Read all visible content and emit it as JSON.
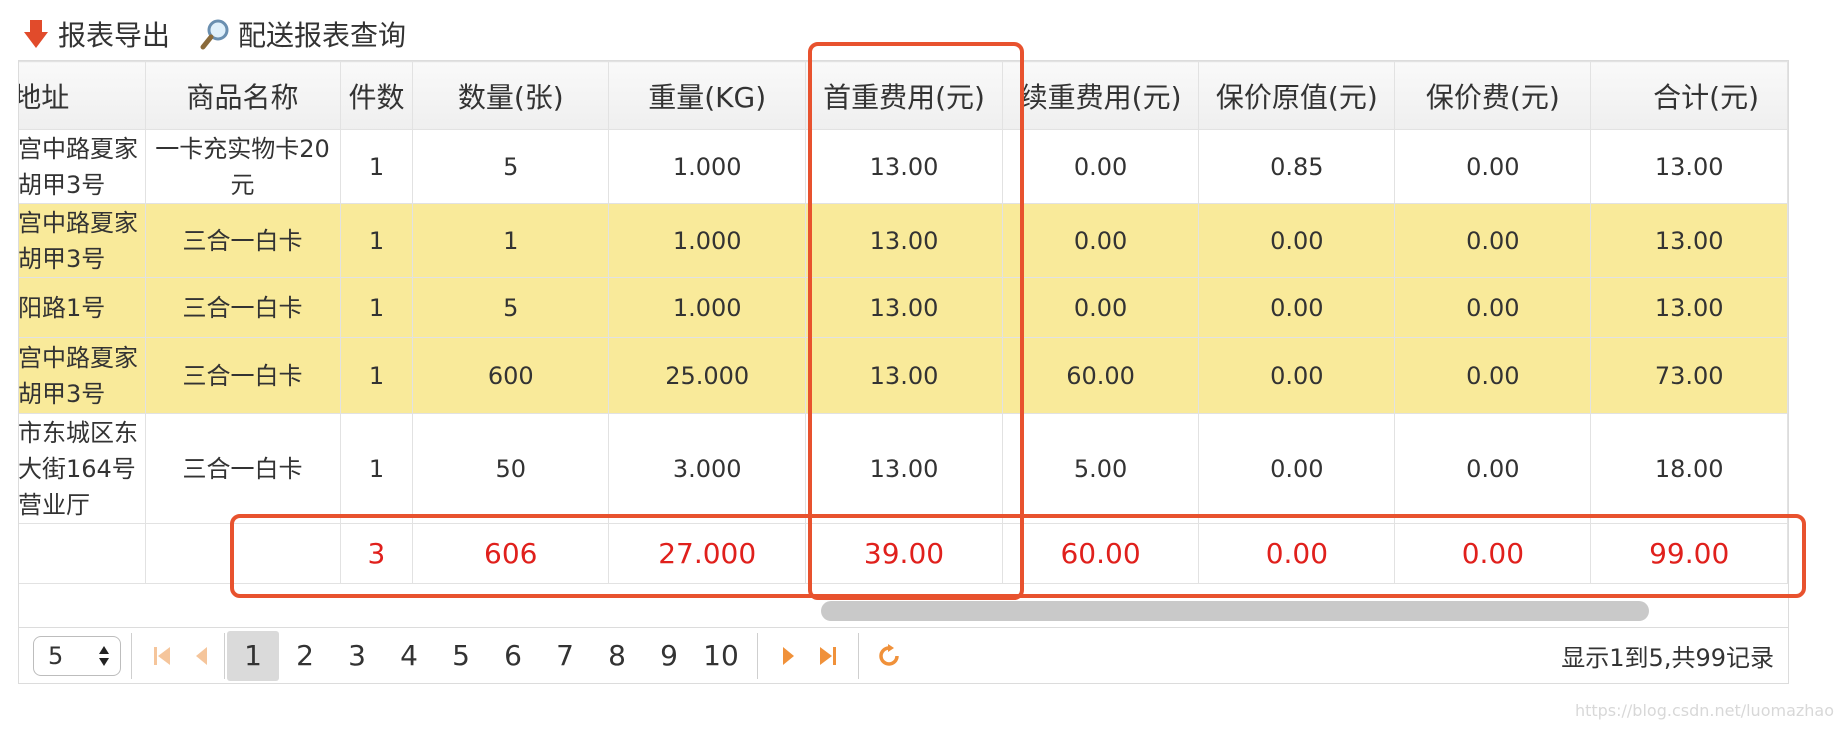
{
  "toolbar": {
    "export_label": "报表导出",
    "query_label": "配送报表查询"
  },
  "table": {
    "headers": [
      "送地址",
      "商品名称",
      "件数",
      "数量(张)",
      "重量(KG)",
      "首重费用(元)",
      "续重费用(元)",
      "保价原值(元)",
      "保价费(元)",
      "合计(元)"
    ],
    "rows": [
      {
        "addr": [
          "宫中路夏家",
          "胡甲3号"
        ],
        "name": "一卡充实物卡20元",
        "pieces": "1",
        "qty": "5",
        "weight": "1.000",
        "first_fee": "13.00",
        "cont_fee": "0.00",
        "insured_val": "0.85",
        "insure_fee": "0.00",
        "total": "13.00"
      },
      {
        "addr": [
          "宫中路夏家",
          "胡甲3号"
        ],
        "name": "三合一白卡",
        "pieces": "1",
        "qty": "1",
        "weight": "1.000",
        "first_fee": "13.00",
        "cont_fee": "0.00",
        "insured_val": "0.00",
        "insure_fee": "0.00",
        "total": "13.00"
      },
      {
        "addr": [
          "阳路1号"
        ],
        "name": "三合一白卡",
        "pieces": "1",
        "qty": "5",
        "weight": "1.000",
        "first_fee": "13.00",
        "cont_fee": "0.00",
        "insured_val": "0.00",
        "insure_fee": "0.00",
        "total": "13.00"
      },
      {
        "addr": [
          "宫中路夏家",
          "胡甲3号"
        ],
        "name": "三合一白卡",
        "pieces": "1",
        "qty": "600",
        "weight": "25.000",
        "first_fee": "13.00",
        "cont_fee": "60.00",
        "insured_val": "0.00",
        "insure_fee": "0.00",
        "total": "73.00"
      },
      {
        "addr": [
          "市东城区东",
          "大街164号",
          "营业厅"
        ],
        "name": "三合一白卡",
        "pieces": "1",
        "qty": "50",
        "weight": "3.000",
        "first_fee": "13.00",
        "cont_fee": "5.00",
        "insured_val": "0.00",
        "insure_fee": "0.00",
        "total": "18.00"
      }
    ],
    "footer": {
      "pieces": "3",
      "qty": "606",
      "weight": "27.000",
      "first_fee": "39.00",
      "cont_fee": "60.00",
      "insured_val": "0.00",
      "insure_fee": "0.00",
      "total": "99.00"
    }
  },
  "pager": {
    "page_size": "5",
    "pages": [
      "1",
      "2",
      "3",
      "4",
      "5",
      "6",
      "7",
      "8",
      "9",
      "10"
    ],
    "current_page": "1",
    "info": "显示1到5,共99记录"
  },
  "watermark": "https://blog.csdn.net/luomazhao",
  "colors": {
    "highlight_row": "#f9ea9a",
    "footer_text": "#e0201c",
    "annotation_box": "#e8522e",
    "nav_icon": "#f0913a"
  },
  "icons": {
    "export": "download-arrow-icon",
    "query": "magnifier-icon"
  }
}
